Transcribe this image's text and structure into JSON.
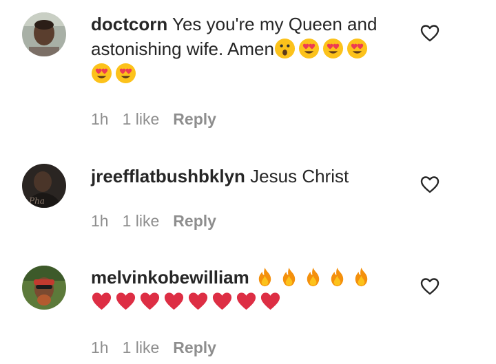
{
  "comments": [
    {
      "username": "doctcorn",
      "text": "Yes you're my Queen and astonishing wife. Amen",
      "emojis": [
        "surprised-face",
        "heart-eyes-face",
        "heart-eyes-face",
        "heart-eyes-face",
        "heart-eyes-face",
        "heart-eyes-face"
      ],
      "time": "1h",
      "likes": "1 like",
      "reply_label": "Reply"
    },
    {
      "username": "jreefflatbushbklyn",
      "text": "Jesus Christ",
      "emojis": [],
      "time": "1h",
      "likes": "1 like",
      "reply_label": "Reply"
    },
    {
      "username": "melvinkobewilliam",
      "text": "",
      "emojis": [
        "fire",
        "fire",
        "fire",
        "fire",
        "fire",
        "red-heart",
        "red-heart",
        "red-heart",
        "red-heart",
        "red-heart",
        "red-heart",
        "red-heart",
        "red-heart"
      ],
      "time": "1h",
      "likes": "1 like",
      "reply_label": "Reply"
    }
  ],
  "colors": {
    "text": "#262626",
    "secondary": "#8e8e8e",
    "background": "#ffffff"
  },
  "icons": {
    "like": "heart-outline-icon"
  }
}
